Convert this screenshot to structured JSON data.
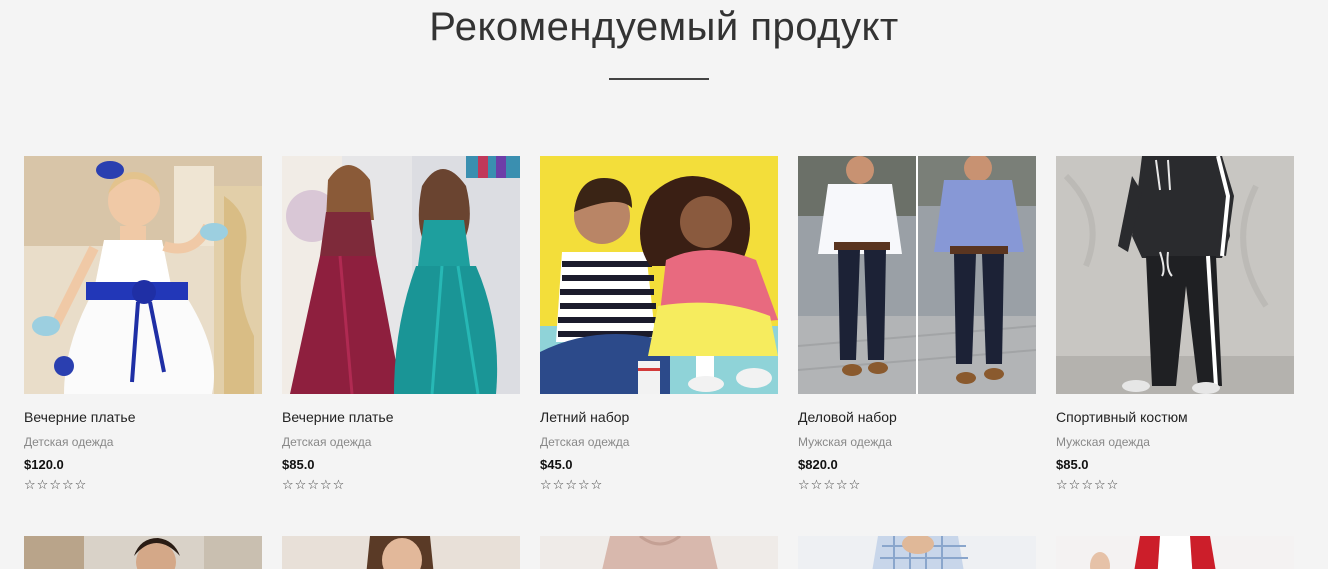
{
  "section": {
    "title": "Рекомендуемый продукт"
  },
  "products": [
    {
      "name": "Вечерние платье",
      "category": "Детская одежда",
      "price": "$120.0",
      "rating": 0,
      "image": "girl-white-dress"
    },
    {
      "name": "Вечерние платье",
      "category": "Детская одежда",
      "price": "$85.0",
      "rating": 0,
      "image": "girls-satin-gowns"
    },
    {
      "name": "Летний набор",
      "category": "Детская одежда",
      "price": "$45.0",
      "rating": 0,
      "image": "kids-summer"
    },
    {
      "name": "Деловой набор",
      "category": "Мужская одежда",
      "price": "$820.0",
      "rating": 0,
      "image": "men-business"
    },
    {
      "name": "Спортивный костюм",
      "category": "Мужская одежда",
      "price": "$85.0",
      "rating": 0,
      "image": "tracksuit"
    }
  ],
  "products_row2": [
    {
      "image": "man-portrait"
    },
    {
      "image": "woman-portrait"
    },
    {
      "image": "beige-sweater"
    },
    {
      "image": "plaid-shirt"
    },
    {
      "image": "red-vest"
    }
  ],
  "star_glyph": "☆"
}
